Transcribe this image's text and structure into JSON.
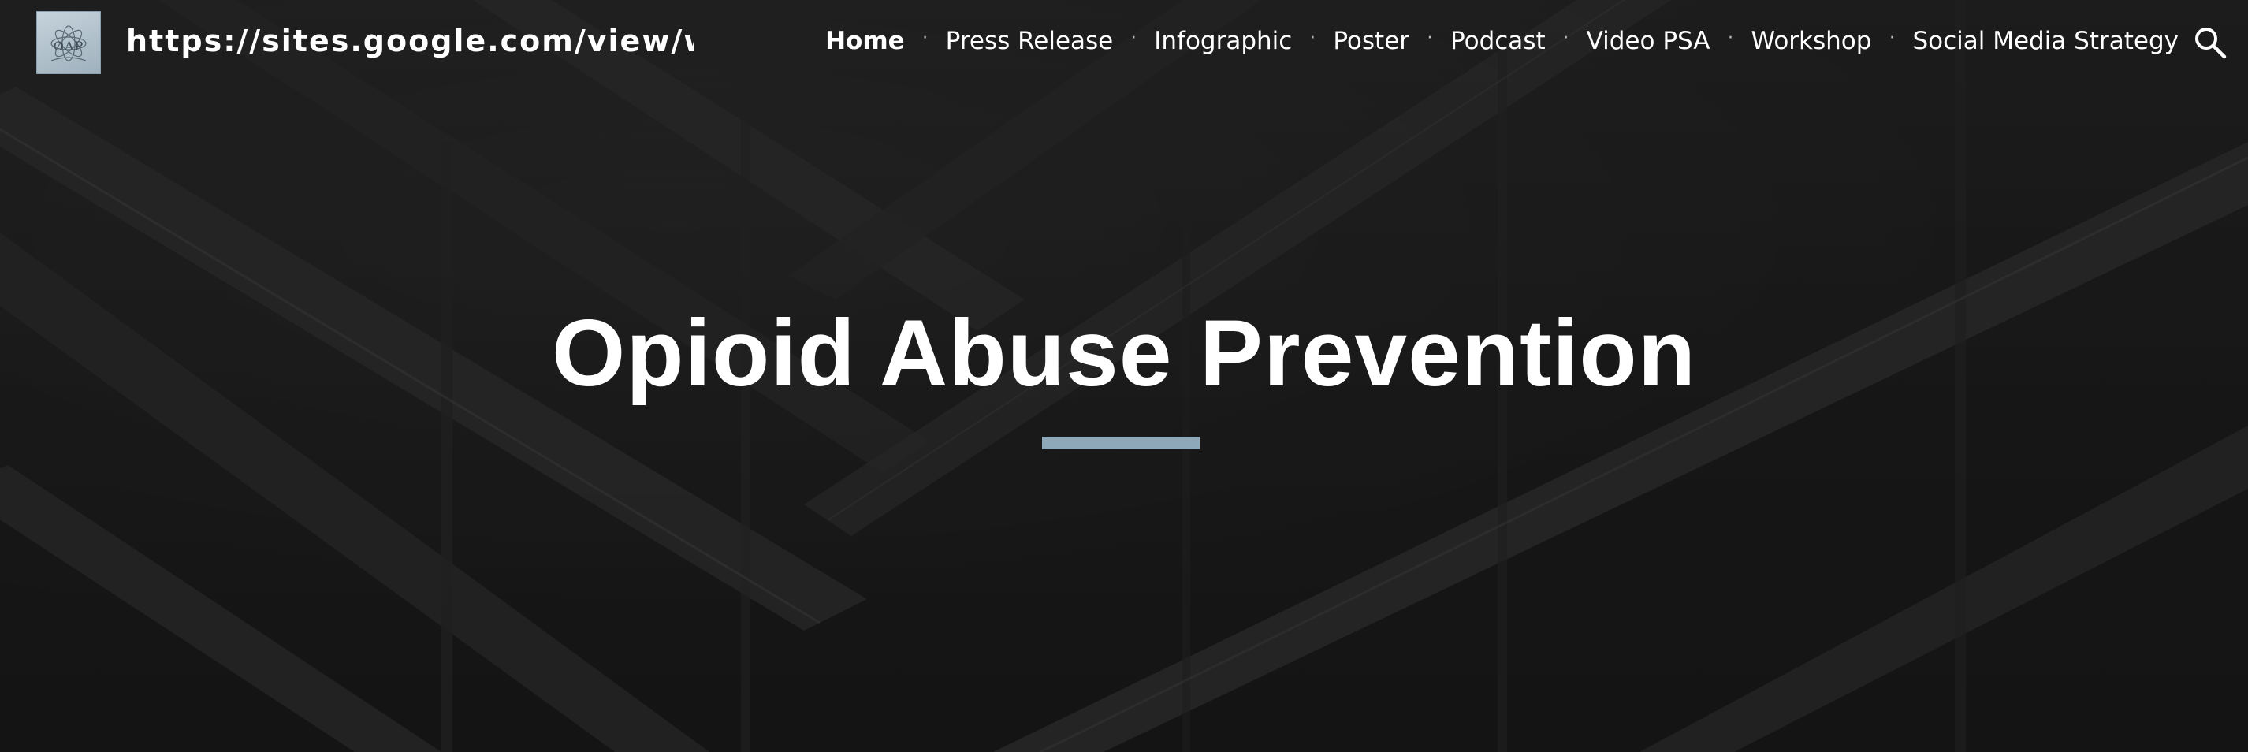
{
  "site": {
    "title": "https://sites.google.com/view/w…",
    "logo_text": "OAP",
    "logo_icon": "lotus-logo-icon"
  },
  "nav": {
    "items": [
      {
        "label": "Home",
        "active": true
      },
      {
        "label": "Press Release",
        "active": false
      },
      {
        "label": "Infographic",
        "active": false
      },
      {
        "label": "Poster",
        "active": false
      },
      {
        "label": "Podcast",
        "active": false
      },
      {
        "label": "Video PSA",
        "active": false
      },
      {
        "label": "Workshop",
        "active": false
      },
      {
        "label": "Social Media Strategy",
        "active": false
      }
    ],
    "separator": "·",
    "search_icon": "search-icon"
  },
  "hero": {
    "title": "Opioid Abuse Prevention",
    "underline_color": "#8ea7b9"
  },
  "colors": {
    "background": "#1f1f1f",
    "text": "#ffffff",
    "accent": "#8ea7b9"
  }
}
